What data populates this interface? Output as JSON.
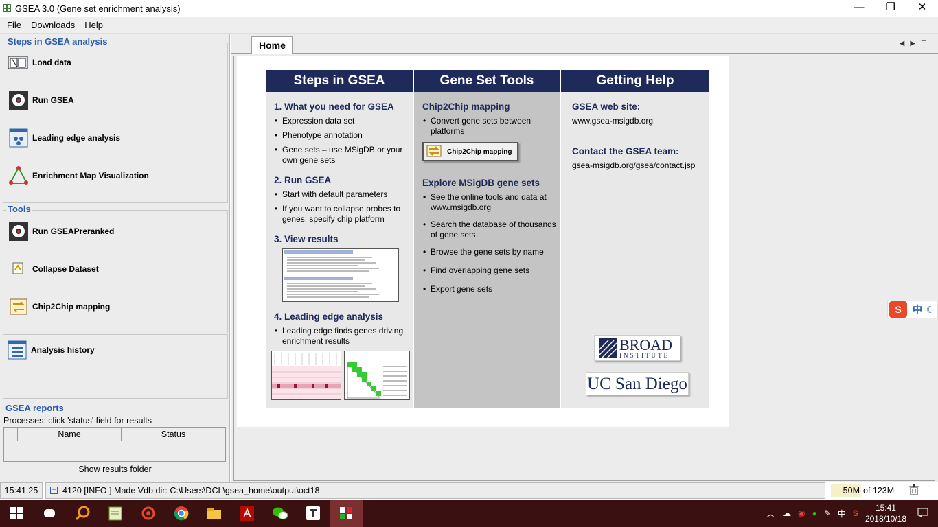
{
  "window": {
    "title": "GSEA 3.0 (Gene set enrichment analysis)",
    "minimize": "—",
    "restore": "❐",
    "close": "✕"
  },
  "menu": [
    "File",
    "Downloads",
    "Help"
  ],
  "left": {
    "steps_title": "Steps in GSEA analysis",
    "steps": [
      "Load data",
      "Run GSEA",
      "Leading edge analysis",
      "Enrichment Map Visualization"
    ],
    "tools_title": "Tools",
    "tools": [
      "Run GSEAPreranked",
      "Collapse Dataset",
      "Chip2Chip mapping"
    ],
    "history": "Analysis history",
    "reports_title": "GSEA reports",
    "processes_text": "Processes: click 'status' field for results",
    "col_name": "Name",
    "col_status": "Status",
    "show_results": "Show results folder"
  },
  "tab": {
    "label": "Home"
  },
  "home": {
    "col1": {
      "header": "Steps in GSEA",
      "s1": "1. What you need for GSEA",
      "s1_items": [
        "Expression data set",
        "Phenotype annotation",
        "Gene sets – use MSigDB or your own gene sets"
      ],
      "s2": "2. Run GSEA",
      "s2_items": [
        "Start with default parameters",
        "If you want to collapse probes to genes, specify chip platform"
      ],
      "s3": "3. View results",
      "s4": "4. Leading edge analysis",
      "s4_items": [
        "Leading edge finds genes driving enrichment results"
      ]
    },
    "col2": {
      "header": "Gene Set Tools",
      "t1": "Chip2Chip mapping",
      "t1_items": [
        "Convert gene sets between platforms"
      ],
      "chip_btn": "Chip2Chip mapping",
      "t2": "Explore MSigDB gene sets",
      "t2_items": [
        "See the online tools and data at www.msigdb.org",
        "Search the database of thousands of gene sets",
        "Browse the gene sets by name",
        "Find overlapping gene sets",
        "Export gene sets"
      ]
    },
    "col3": {
      "header": "Getting Help",
      "web_title": "GSEA web site:",
      "web_url": "www.gsea-msigdb.org",
      "contact_title": "Contact the GSEA team:",
      "contact_url": "gsea-msigdb.org/gsea/contact.jsp",
      "broad": "BROAD",
      "broad_sub": "INSTITUTE",
      "ucsd": "UC San Diego"
    }
  },
  "status": {
    "time": "15:41:25",
    "message": "4120 [INFO ] Made Vdb dir: C:\\Users\\DCL\\gsea_home\\output\\oct18",
    "mem_used": "50M",
    "mem_total": "of 123M"
  },
  "ime": {
    "label": "中"
  },
  "taskbar": {
    "tray_lang": "中",
    "clock_time": "15:41",
    "clock_date": "2018/10/18"
  }
}
